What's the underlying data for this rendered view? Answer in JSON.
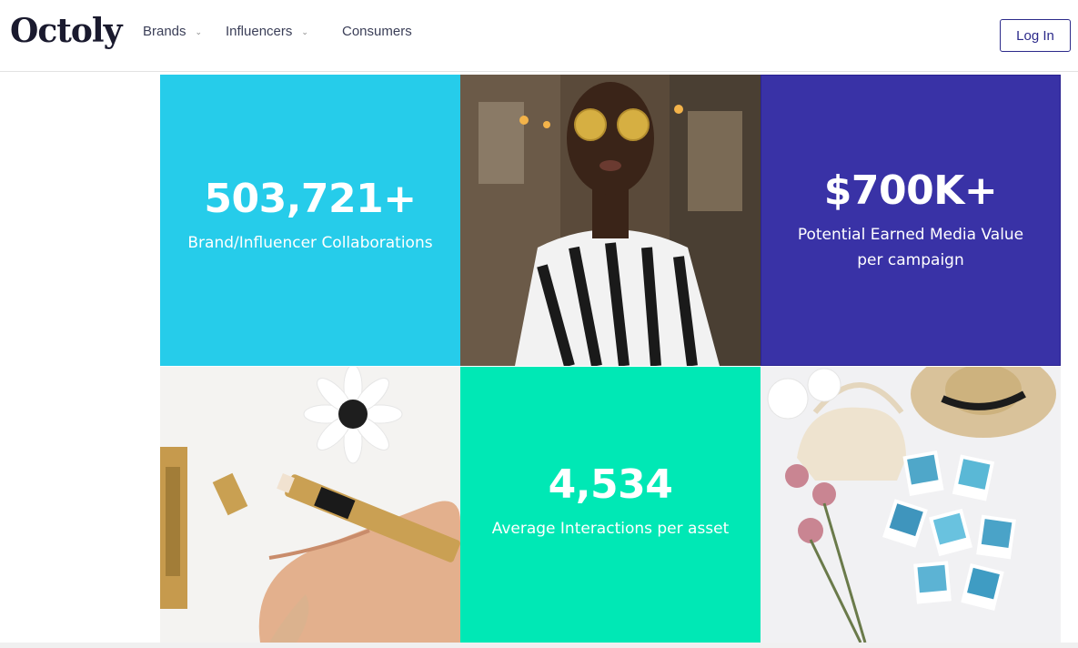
{
  "header": {
    "logo": "Octoly",
    "nav": [
      {
        "label": "Brands",
        "has_dropdown": true
      },
      {
        "label": "Influencers",
        "has_dropdown": true
      },
      {
        "label": "Consumers",
        "has_dropdown": false
      }
    ],
    "login_label": "Log In"
  },
  "stats": {
    "collaborations": {
      "value": "503,721+",
      "label": "Brand/Influencer Collaborations",
      "color": "#26ccea"
    },
    "media_value": {
      "value": "$700K+",
      "label": "Potential Earned Media Value per campaign",
      "color": "#3932a6"
    },
    "interactions": {
      "value": "4,534",
      "label": "Average Interactions per asset",
      "color": "#00e8b5"
    }
  },
  "photos": {
    "woman": "photo-woman-striped-shirt",
    "cosmetics": "photo-makeup-pen-flower",
    "flatlay": "photo-straw-hat-polaroids"
  }
}
